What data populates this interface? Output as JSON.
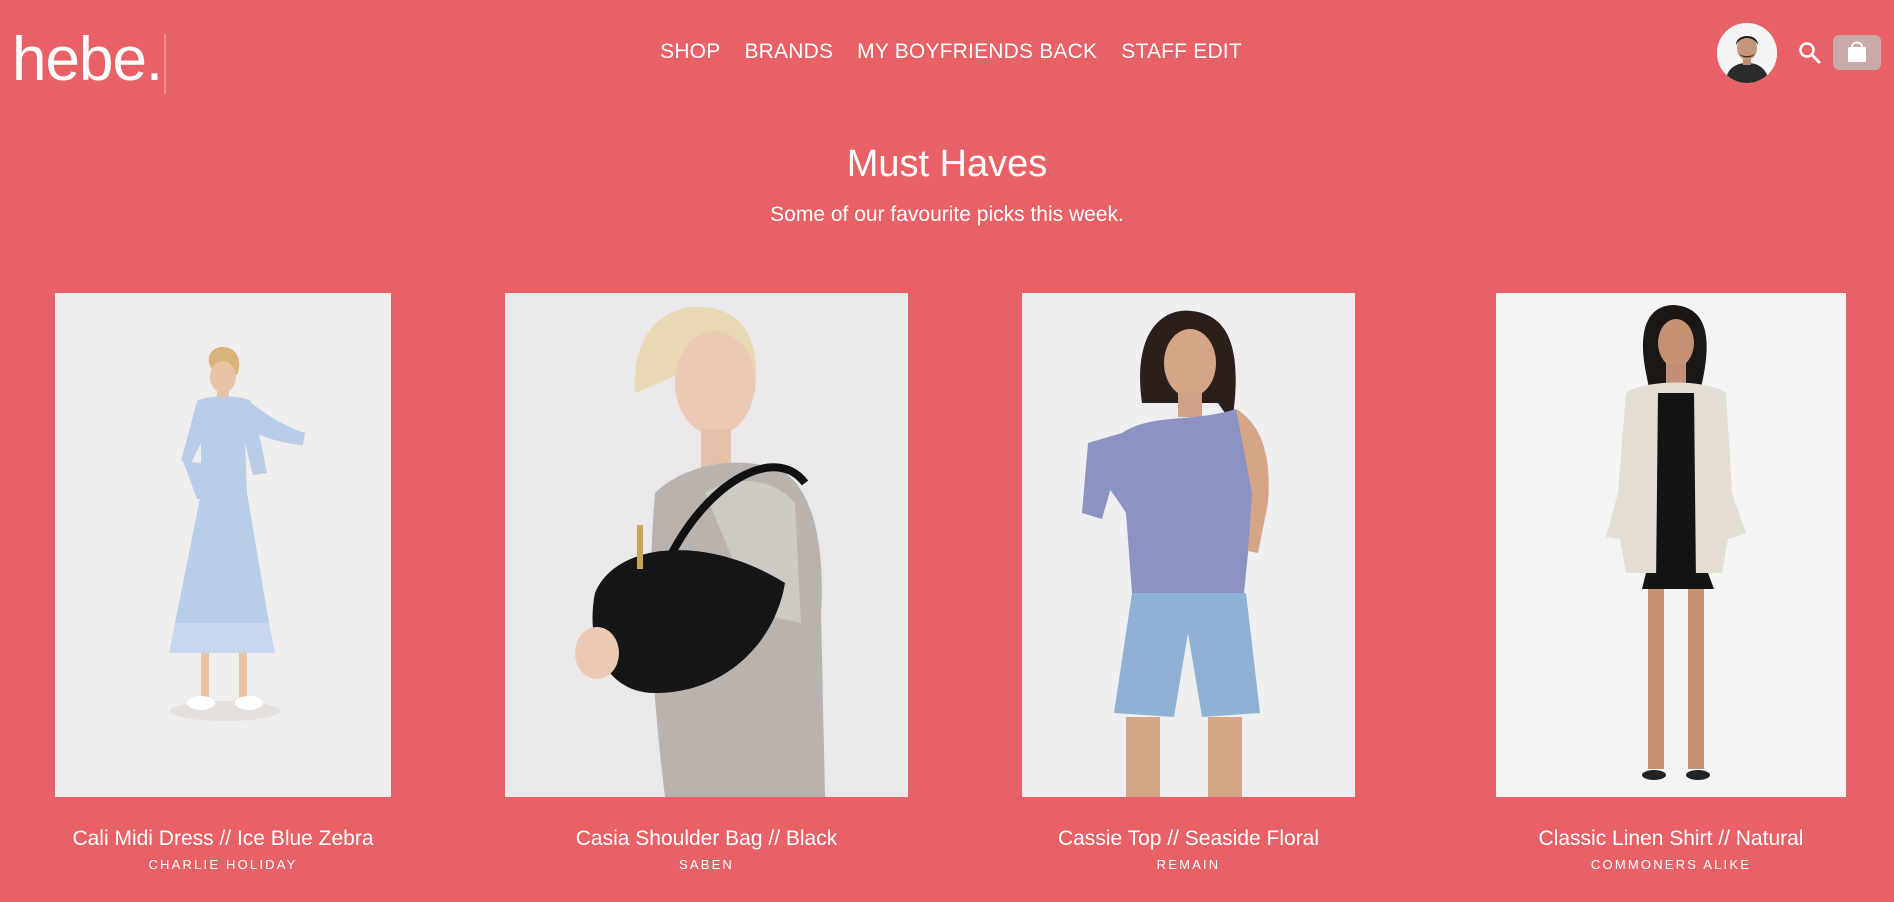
{
  "header": {
    "logo_text": "hebe.",
    "nav": [
      {
        "label": "SHOP"
      },
      {
        "label": "BRANDS"
      },
      {
        "label": "MY BOYFRIENDS BACK"
      },
      {
        "label": "STAFF EDIT"
      }
    ],
    "icons": {
      "avatar": "user-avatar",
      "search": "search-icon",
      "cart": "shopping-bag-icon"
    }
  },
  "section": {
    "title": "Must Haves",
    "subtitle": "Some of our favourite picks this week."
  },
  "products": [
    {
      "name": "Cali Midi Dress // Ice Blue Zebra",
      "brand": "CHARLIE HOLIDAY"
    },
    {
      "name": "Casia Shoulder Bag // Black",
      "brand": "SABEN"
    },
    {
      "name": "Cassie Top // Seaside Floral",
      "brand": "REMAIN"
    },
    {
      "name": "Classic Linen Shirt // Natural",
      "brand": "COMMONERS ALIKE"
    }
  ],
  "colors": {
    "background": "#e86166",
    "text": "#ffffff",
    "cart_button": "#c9aaa8"
  }
}
